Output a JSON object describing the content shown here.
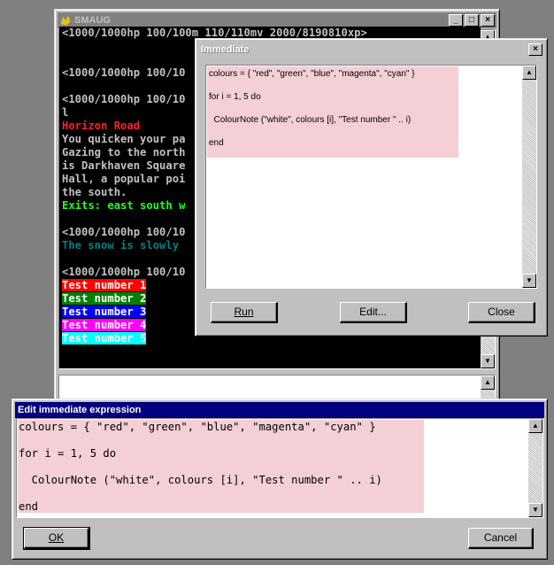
{
  "smaug": {
    "title": "SMAUG",
    "controls": {
      "minimize": "_",
      "maximize": "□",
      "close": "×"
    },
    "lines": [
      {
        "text": "<1000/1000hp 100/100m 110/110mv 2000/8190810xp>",
        "color": "#c0c0c0"
      },
      {
        "text": "",
        "color": "#c0c0c0"
      },
      {
        "text": "",
        "color": "#c0c0c0"
      },
      {
        "text": "<1000/1000hp 100/10",
        "color": "#c0c0c0"
      },
      {
        "text": "",
        "color": "#c0c0c0"
      },
      {
        "text": "<1000/1000hp 100/10",
        "color": "#c0c0c0"
      },
      {
        "text": "l",
        "color": "#c0c0c0"
      },
      {
        "text": "Horizon Road",
        "color": "#ff2020"
      },
      {
        "text": "You quicken your pa",
        "color": "#c0c0c0"
      },
      {
        "text": "Gazing to the north",
        "color": "#c0c0c0"
      },
      {
        "text": "is Darkhaven Square",
        "color": "#c0c0c0"
      },
      {
        "text": "Hall, a popular poi",
        "color": "#c0c0c0"
      },
      {
        "text": "the south.",
        "color": "#c0c0c0"
      },
      {
        "text": "Exits: east south w",
        "color": "#20ff20"
      },
      {
        "text": "",
        "color": "#c0c0c0"
      },
      {
        "text": "<1000/1000hp 100/10",
        "color": "#c0c0c0"
      },
      {
        "text": "The snow is slowly ",
        "color": "#008080"
      },
      {
        "text": "",
        "color": "#c0c0c0"
      },
      {
        "text": "<1000/1000hp 100/10",
        "color": "#c0c0c0"
      }
    ],
    "test_lines": [
      {
        "text": "Test number 1",
        "bg": "#ff0000"
      },
      {
        "text": "Test number 2",
        "bg": "#008000"
      },
      {
        "text": "Test number 3",
        "bg": "#0000ff"
      },
      {
        "text": "Test number 4",
        "bg": "#ff00ff"
      },
      {
        "text": "Test number 5",
        "bg": "#00ffff"
      }
    ]
  },
  "immediate": {
    "title": "Immediate",
    "close": "×",
    "code": [
      "colours = { \"red\", \"green\", \"blue\", \"magenta\", \"cyan\" }",
      "for i = 1, 5 do",
      "  ColourNote (\"white\", colours [i], \"Test number \" .. i)",
      "end"
    ],
    "buttons": {
      "run": "Run",
      "edit": "Edit...",
      "close": "Close"
    }
  },
  "edit_dialog": {
    "title": "Edit immediate expression",
    "code": [
      "colours = { \"red\", \"green\", \"blue\", \"magenta\", \"cyan\" }",
      "for i = 1, 5 do",
      "  ColourNote (\"white\", colours [i], \"Test number \" .. i)",
      "end"
    ],
    "buttons": {
      "ok": "OK",
      "cancel": "Cancel"
    }
  }
}
